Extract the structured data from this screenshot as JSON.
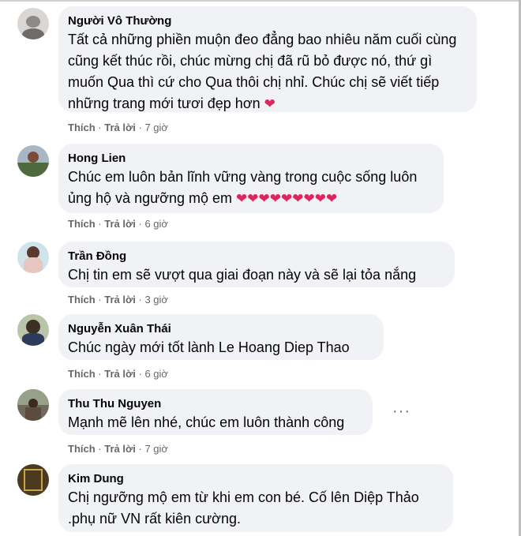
{
  "comments": [
    {
      "name": "Người Vô Thường",
      "text": "Tất cả những phiền muộn đeo đẳng bao nhiêu năm cuối cùng cũng kết thúc rồi, chúc mừng chị đã rũ bỏ được nó, thứ gì muốn Qua thì cứ cho Qua thôi chị nhỉ. Chúc chị sẽ viết tiếp những trang mới tươi đẹp hơn",
      "hearts": "❤",
      "like": "Thích",
      "reply": "Trả lời",
      "time": "7 giờ"
    },
    {
      "name": "Hong Lien",
      "text": "Chúc em luôn bản lĩnh vững vàng trong cuộc sống luôn ủng hộ và ngưỡng mộ em",
      "hearts": "❤❤❤❤❤❤❤❤❤",
      "like": "Thích",
      "reply": "Trả lời",
      "time": "6 giờ"
    },
    {
      "name": "Trần Đồng",
      "text": "Chị tin em sẽ vượt qua giai đoạn này và sẽ lại tỏa nắng",
      "hearts": "",
      "like": "Thích",
      "reply": "Trả lời",
      "time": "3 giờ"
    },
    {
      "name": "Nguyễn Xuân Thái",
      "text": "Chúc ngày mới tốt lành Le Hoang Diep Thao",
      "hearts": "",
      "like": "Thích",
      "reply": "Trả lời",
      "time": "6 giờ"
    },
    {
      "name": "Thu Thu Nguyen",
      "text": "Mạnh mẽ lên nhé, chúc em luôn thành công",
      "hearts": "",
      "like": "Thích",
      "reply": "Trả lời",
      "time": "7 giờ",
      "more": "···"
    },
    {
      "name": "Kim Dung",
      "text": "Chị ngưỡng mộ em từ khi em con bé. Cố lên Diệp Thảo .phụ nữ VN rất kiên cường.",
      "hearts": ""
    }
  ],
  "separator": "·",
  "colors": {
    "bubble": "#f0f2f5",
    "meta": "#65676b",
    "heart": "#e0245e"
  }
}
